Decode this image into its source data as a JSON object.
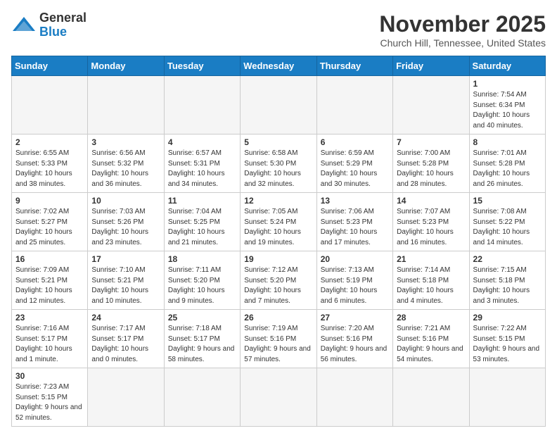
{
  "header": {
    "logo_general": "General",
    "logo_blue": "Blue",
    "month_title": "November 2025",
    "location": "Church Hill, Tennessee, United States"
  },
  "weekdays": [
    "Sunday",
    "Monday",
    "Tuesday",
    "Wednesday",
    "Thursday",
    "Friday",
    "Saturday"
  ],
  "weeks": [
    [
      {
        "day": "",
        "info": ""
      },
      {
        "day": "",
        "info": ""
      },
      {
        "day": "",
        "info": ""
      },
      {
        "day": "",
        "info": ""
      },
      {
        "day": "",
        "info": ""
      },
      {
        "day": "",
        "info": ""
      },
      {
        "day": "1",
        "info": "Sunrise: 7:54 AM\nSunset: 6:34 PM\nDaylight: 10 hours and 40 minutes."
      }
    ],
    [
      {
        "day": "2",
        "info": "Sunrise: 6:55 AM\nSunset: 5:33 PM\nDaylight: 10 hours and 38 minutes."
      },
      {
        "day": "3",
        "info": "Sunrise: 6:56 AM\nSunset: 5:32 PM\nDaylight: 10 hours and 36 minutes."
      },
      {
        "day": "4",
        "info": "Sunrise: 6:57 AM\nSunset: 5:31 PM\nDaylight: 10 hours and 34 minutes."
      },
      {
        "day": "5",
        "info": "Sunrise: 6:58 AM\nSunset: 5:30 PM\nDaylight: 10 hours and 32 minutes."
      },
      {
        "day": "6",
        "info": "Sunrise: 6:59 AM\nSunset: 5:29 PM\nDaylight: 10 hours and 30 minutes."
      },
      {
        "day": "7",
        "info": "Sunrise: 7:00 AM\nSunset: 5:28 PM\nDaylight: 10 hours and 28 minutes."
      },
      {
        "day": "8",
        "info": "Sunrise: 7:01 AM\nSunset: 5:28 PM\nDaylight: 10 hours and 26 minutes."
      }
    ],
    [
      {
        "day": "9",
        "info": "Sunrise: 7:02 AM\nSunset: 5:27 PM\nDaylight: 10 hours and 25 minutes."
      },
      {
        "day": "10",
        "info": "Sunrise: 7:03 AM\nSunset: 5:26 PM\nDaylight: 10 hours and 23 minutes."
      },
      {
        "day": "11",
        "info": "Sunrise: 7:04 AM\nSunset: 5:25 PM\nDaylight: 10 hours and 21 minutes."
      },
      {
        "day": "12",
        "info": "Sunrise: 7:05 AM\nSunset: 5:24 PM\nDaylight: 10 hours and 19 minutes."
      },
      {
        "day": "13",
        "info": "Sunrise: 7:06 AM\nSunset: 5:23 PM\nDaylight: 10 hours and 17 minutes."
      },
      {
        "day": "14",
        "info": "Sunrise: 7:07 AM\nSunset: 5:23 PM\nDaylight: 10 hours and 16 minutes."
      },
      {
        "day": "15",
        "info": "Sunrise: 7:08 AM\nSunset: 5:22 PM\nDaylight: 10 hours and 14 minutes."
      }
    ],
    [
      {
        "day": "16",
        "info": "Sunrise: 7:09 AM\nSunset: 5:21 PM\nDaylight: 10 hours and 12 minutes."
      },
      {
        "day": "17",
        "info": "Sunrise: 7:10 AM\nSunset: 5:21 PM\nDaylight: 10 hours and 10 minutes."
      },
      {
        "day": "18",
        "info": "Sunrise: 7:11 AM\nSunset: 5:20 PM\nDaylight: 10 hours and 9 minutes."
      },
      {
        "day": "19",
        "info": "Sunrise: 7:12 AM\nSunset: 5:20 PM\nDaylight: 10 hours and 7 minutes."
      },
      {
        "day": "20",
        "info": "Sunrise: 7:13 AM\nSunset: 5:19 PM\nDaylight: 10 hours and 6 minutes."
      },
      {
        "day": "21",
        "info": "Sunrise: 7:14 AM\nSunset: 5:18 PM\nDaylight: 10 hours and 4 minutes."
      },
      {
        "day": "22",
        "info": "Sunrise: 7:15 AM\nSunset: 5:18 PM\nDaylight: 10 hours and 3 minutes."
      }
    ],
    [
      {
        "day": "23",
        "info": "Sunrise: 7:16 AM\nSunset: 5:17 PM\nDaylight: 10 hours and 1 minute."
      },
      {
        "day": "24",
        "info": "Sunrise: 7:17 AM\nSunset: 5:17 PM\nDaylight: 10 hours and 0 minutes."
      },
      {
        "day": "25",
        "info": "Sunrise: 7:18 AM\nSunset: 5:17 PM\nDaylight: 9 hours and 58 minutes."
      },
      {
        "day": "26",
        "info": "Sunrise: 7:19 AM\nSunset: 5:16 PM\nDaylight: 9 hours and 57 minutes."
      },
      {
        "day": "27",
        "info": "Sunrise: 7:20 AM\nSunset: 5:16 PM\nDaylight: 9 hours and 56 minutes."
      },
      {
        "day": "28",
        "info": "Sunrise: 7:21 AM\nSunset: 5:16 PM\nDaylight: 9 hours and 54 minutes."
      },
      {
        "day": "29",
        "info": "Sunrise: 7:22 AM\nSunset: 5:15 PM\nDaylight: 9 hours and 53 minutes."
      }
    ],
    [
      {
        "day": "30",
        "info": "Sunrise: 7:23 AM\nSunset: 5:15 PM\nDaylight: 9 hours and 52 minutes."
      },
      {
        "day": "",
        "info": ""
      },
      {
        "day": "",
        "info": ""
      },
      {
        "day": "",
        "info": ""
      },
      {
        "day": "",
        "info": ""
      },
      {
        "day": "",
        "info": ""
      },
      {
        "day": "",
        "info": ""
      }
    ]
  ]
}
